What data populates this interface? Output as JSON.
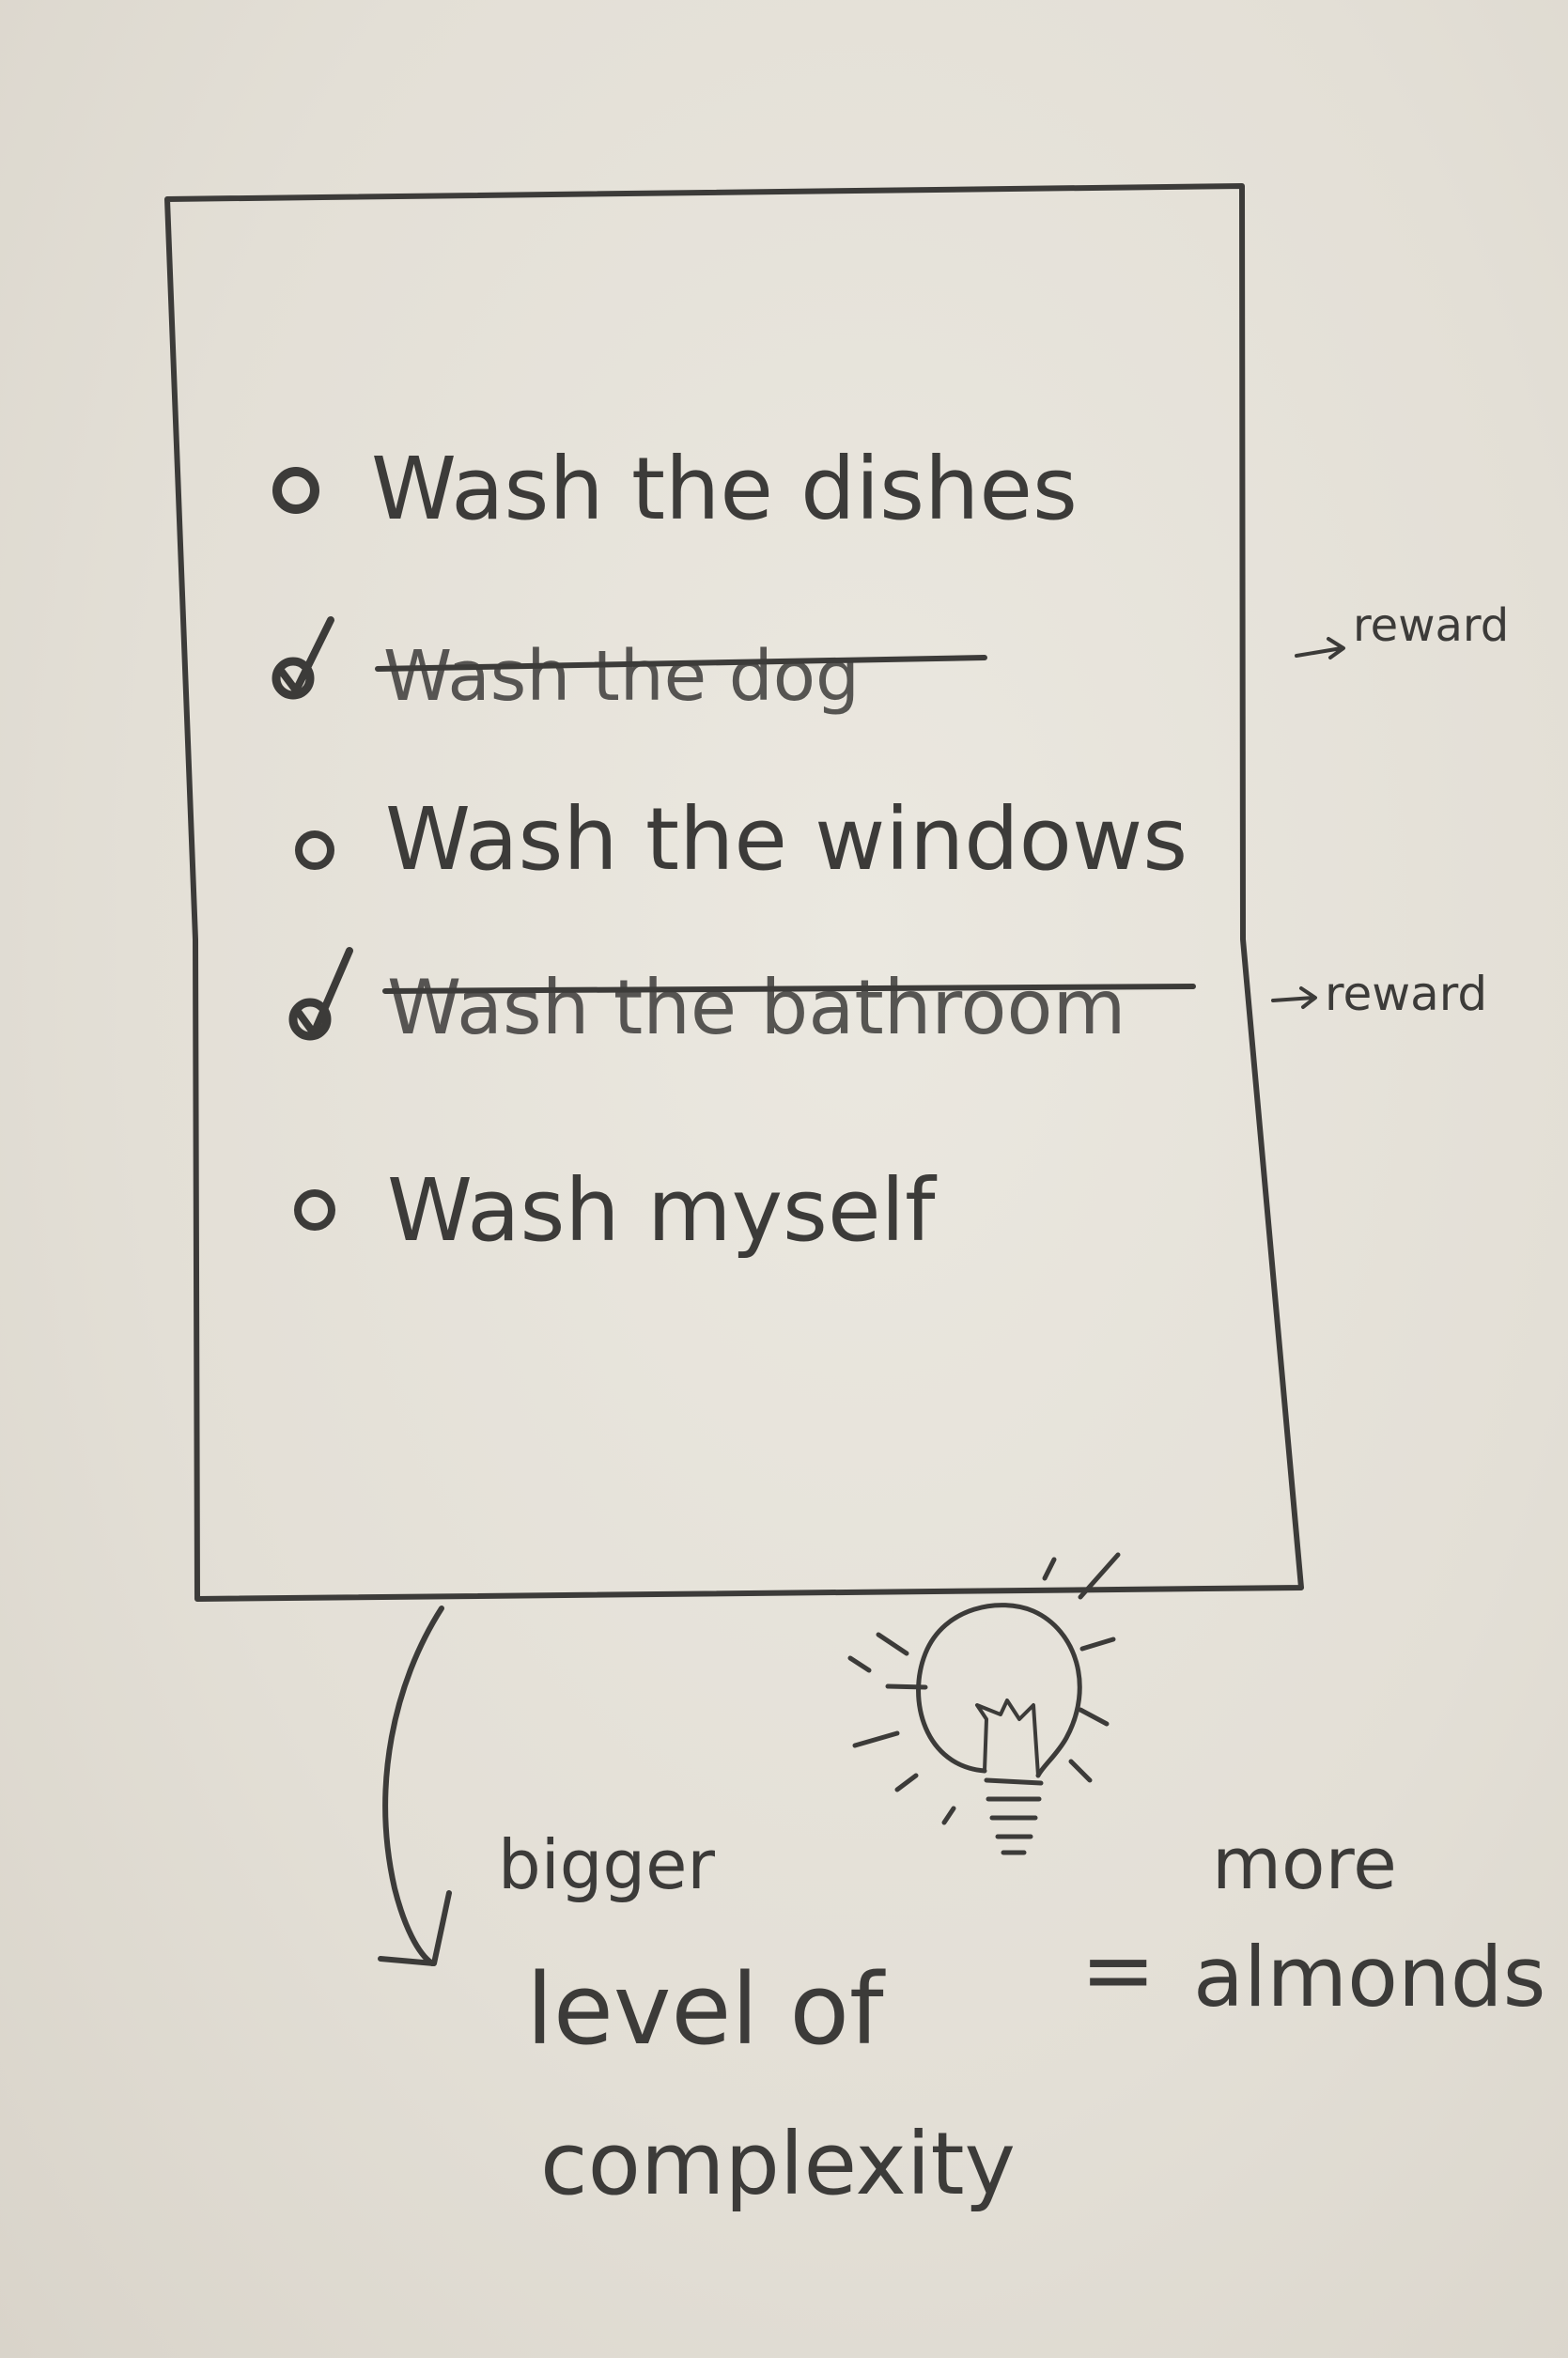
{
  "todo_list": {
    "items": [
      {
        "label": "Wash the dishes",
        "checked": false
      },
      {
        "label": "Wash the dog",
        "checked": true
      },
      {
        "label": "Wash the windows",
        "checked": false
      },
      {
        "label": "Wash the bathroom",
        "checked": true
      },
      {
        "label": "Wash myself",
        "checked": false
      }
    ]
  },
  "annotations": {
    "reward_dog": "reward",
    "reward_bathroom": "reward"
  },
  "note": {
    "line1": "bigger",
    "line2": "level of",
    "line3": "complexity",
    "equals": "=",
    "result_line1": "more",
    "result_line2": "almonds"
  },
  "icons": {
    "idea": "lightbulb-icon",
    "check": "check-icon",
    "circle": "circle-icon"
  },
  "colors": {
    "ink": "#3c3b39",
    "paper": "#e6e2d9"
  }
}
